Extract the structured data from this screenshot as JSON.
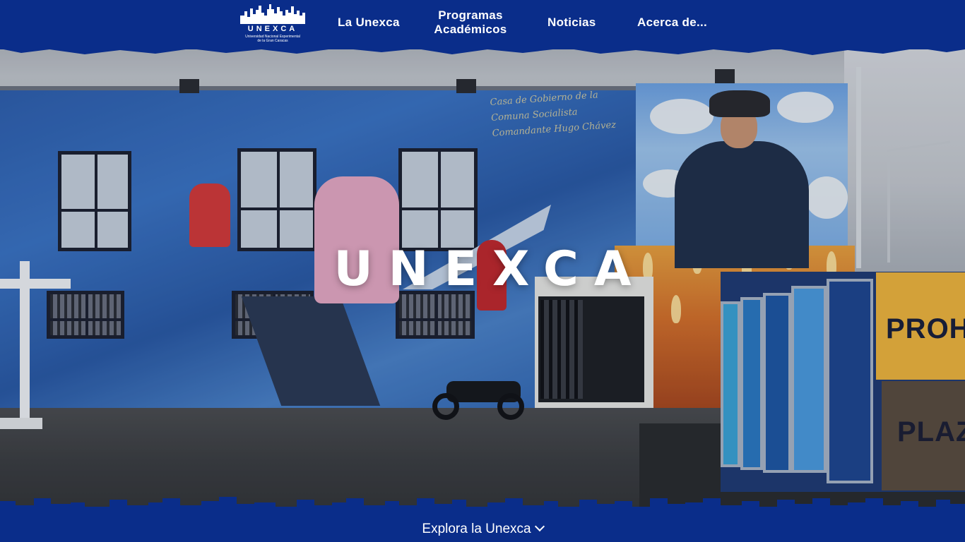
{
  "logo": {
    "wordmark": "UNEXCA",
    "subtitle_line1": "Universidad Nacional Experimental",
    "subtitle_line2": "de la Gran Caracas",
    "icon": "city-skyline-icon"
  },
  "nav": {
    "items": [
      {
        "label": "La Unexca"
      },
      {
        "label": "Programas Académicos"
      },
      {
        "label": "Noticias"
      },
      {
        "label": "Acerca de..."
      }
    ]
  },
  "hero": {
    "title": "UNEXCA",
    "mural_text": "Casa de Gobierno de la Comuna Socialista Comandante Hugo Chávez",
    "sign_line1": "PROH",
    "sign_line2": "PLAZ"
  },
  "footer": {
    "explore_label": "Explora la Unexca",
    "explore_icon": "chevron-down-icon"
  },
  "colors": {
    "brand_blue": "#0a2d8a",
    "text_white": "#ffffff"
  }
}
